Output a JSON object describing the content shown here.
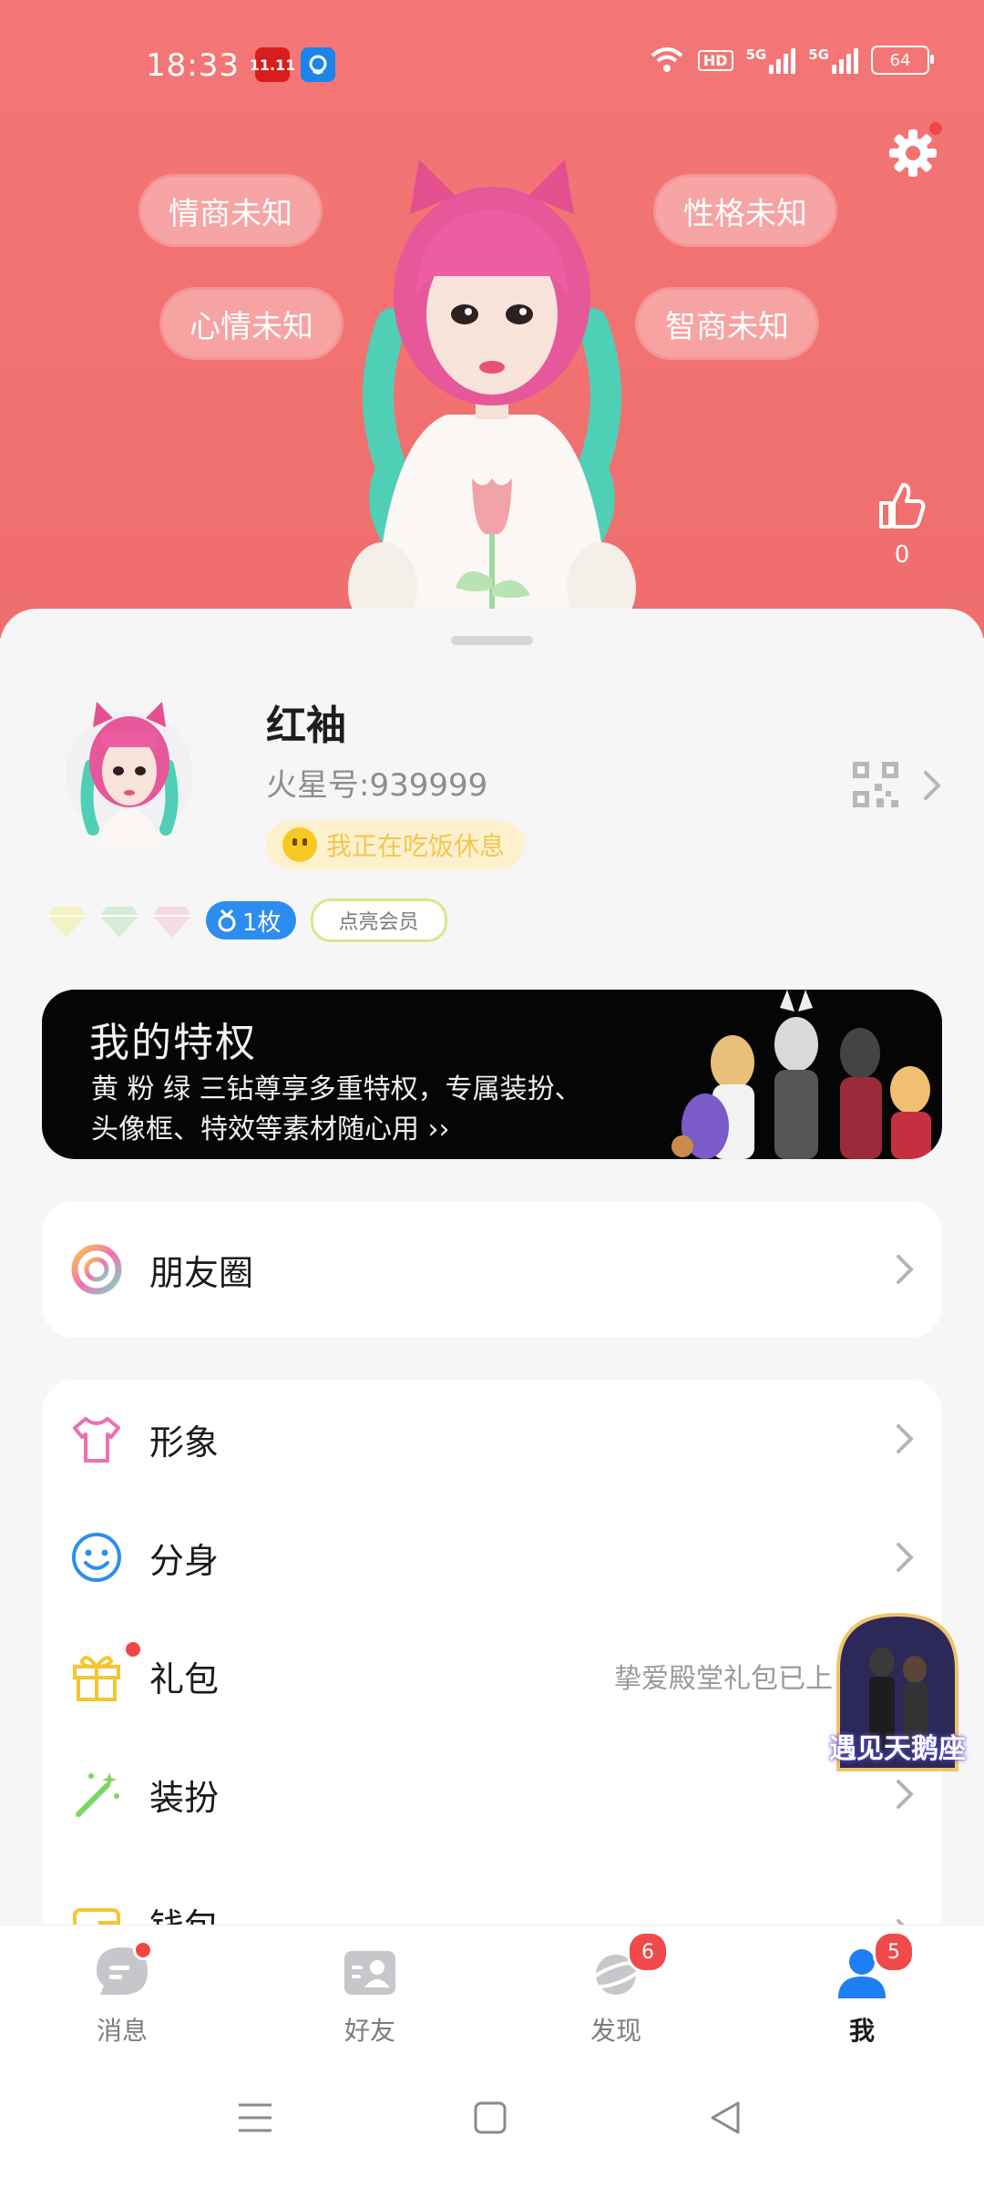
{
  "status_bar": {
    "time": "18:33",
    "app_icon_1": "11.11",
    "battery": "64",
    "hd_label": "HD",
    "net_1": "5G",
    "net_2": "5G"
  },
  "hero": {
    "bubbles": [
      "情商未知",
      "性格未知",
      "心情未知",
      "智商未知"
    ],
    "likes": "0"
  },
  "profile": {
    "name": "红袖",
    "uid": "火星号:939999",
    "status_text": "我正在吃饭休息",
    "medal_label": "1枚",
    "vip_button": "点亮会员"
  },
  "privilege": {
    "title": "我的特权",
    "desc": "黄 粉 绿 三钻尊享多重特权，专属装扮、头像框、特效等素材随心用 ››"
  },
  "menu": {
    "moments": "朋友圈",
    "items": [
      {
        "label": "形象",
        "extra": ""
      },
      {
        "label": "分身",
        "extra": ""
      },
      {
        "label": "礼包",
        "extra": "挚爱殿堂礼包已上"
      },
      {
        "label": "装扮",
        "extra": ""
      },
      {
        "label": "钱包",
        "extra": ""
      }
    ]
  },
  "float_ad": {
    "text": "遇见天鹅座"
  },
  "tabs": [
    {
      "label": "消息",
      "badge": ""
    },
    {
      "label": "好友",
      "badge": ""
    },
    {
      "label": "发现",
      "badge": "6"
    },
    {
      "label": "我",
      "badge": "5"
    }
  ],
  "colors": {
    "hero_bg": "#f47676",
    "accent_blue": "#1f7ef3",
    "badge_red": "#f04a4a"
  }
}
